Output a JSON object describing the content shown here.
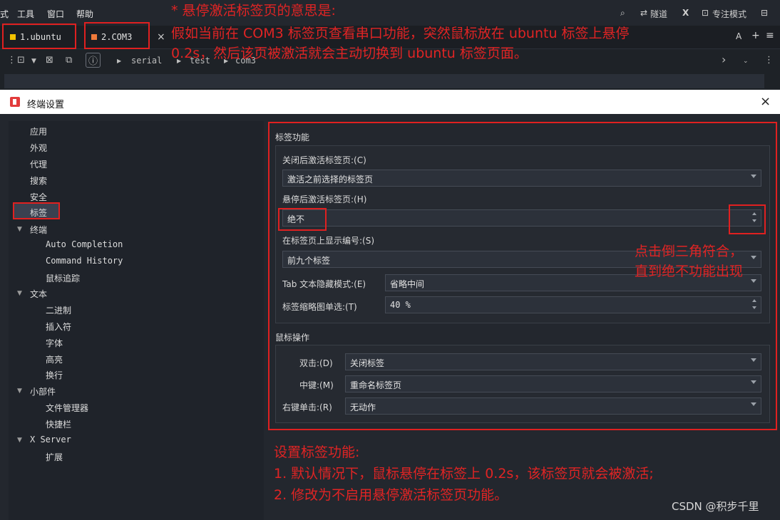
{
  "menubar": {
    "items": [
      "式",
      "工具",
      "窗口",
      "帮助"
    ],
    "right": {
      "tunnel": "隧道",
      "x": "X",
      "focus": "专注模式"
    }
  },
  "tabs": [
    {
      "label": "1.ubuntu",
      "color": "#f2c200"
    },
    {
      "label": "2.COM3",
      "color": "#f07a3a"
    }
  ],
  "tab_close": "×",
  "tabbar_right": {
    "font": "A",
    "add": "+",
    "menu": "≡"
  },
  "toolbar": {
    "icons": [
      "grip-icon",
      "new-tab-icon",
      "dropdown-icon",
      "close-tab-icon",
      "copy-icon",
      "info-icon"
    ],
    "breadcrumb": [
      "serial",
      "test",
      "com3"
    ],
    "info": "ⓘ"
  },
  "dialog": {
    "title": "终端设置",
    "close": "×",
    "tree": [
      {
        "label": "应用",
        "level": 0
      },
      {
        "label": "外观",
        "level": 0
      },
      {
        "label": "代理",
        "level": 0
      },
      {
        "label": "搜索",
        "level": 0
      },
      {
        "label": "安全",
        "level": 0
      },
      {
        "label": "标签",
        "level": 0,
        "selected": true
      },
      {
        "label": "终端",
        "level": 0,
        "expandable": true
      },
      {
        "label": "Auto Completion",
        "level": 1
      },
      {
        "label": "Command History",
        "level": 1
      },
      {
        "label": "鼠标追踪",
        "level": 1
      },
      {
        "label": "文本",
        "level": 0,
        "expandable": true
      },
      {
        "label": "二进制",
        "level": 1
      },
      {
        "label": "插入符",
        "level": 1
      },
      {
        "label": "字体",
        "level": 1
      },
      {
        "label": "高亮",
        "level": 1
      },
      {
        "label": "换行",
        "level": 1
      },
      {
        "label": "小部件",
        "level": 0,
        "expandable": true
      },
      {
        "label": "文件管理器",
        "level": 1
      },
      {
        "label": "快捷栏",
        "level": 1
      },
      {
        "label": "X Server",
        "level": 0,
        "expandable": true
      },
      {
        "label": "扩展",
        "level": 1
      }
    ],
    "tab_features": {
      "title": "标签功能",
      "close_activate_label": "关闭后激活标签页:(C)",
      "close_activate_value": "激活之前选择的标签页",
      "hover_activate_label": "悬停后激活标签页:(H)",
      "hover_activate_value": "绝不",
      "show_number_label": "在标签页上显示编号:(S)",
      "show_number_value": "前九个标签",
      "hide_mode_label": "Tab 文本隐藏模式:(E)",
      "hide_mode_value": "省略中间",
      "thumb_label": "标签缩略图单选:(T)",
      "thumb_value": "40 %"
    },
    "mouse": {
      "title": "鼠标操作",
      "dbl_label": "双击:(D)",
      "dbl_value": "关闭标签",
      "mid_label": "中键:(M)",
      "mid_value": "重命名标签页",
      "right_label": "右键单击:(R)",
      "right_value": "无动作"
    }
  },
  "annotations": {
    "top1": "* 悬停激活标签页的意思是:",
    "top2": "假如当前在 COM3 标签页查看串口功能，突然鼠标放在 ubuntu 标签上悬停",
    "top3": "0.2s，然后该页被激活就会主动切换到 ubuntu 标签页面。",
    "mid1": "点击倒三角符合，",
    "mid2": "直到绝不功能出现",
    "bot1": "设置标签功能:",
    "bot2": "1. 默认情况下，鼠标悬停在标签上 0.2s，该标签页就会被激活;",
    "bot3": "2. 修改为不启用悬停激活标签页功能。",
    "color": "#e02424"
  },
  "watermark": "CSDN @积步千里"
}
